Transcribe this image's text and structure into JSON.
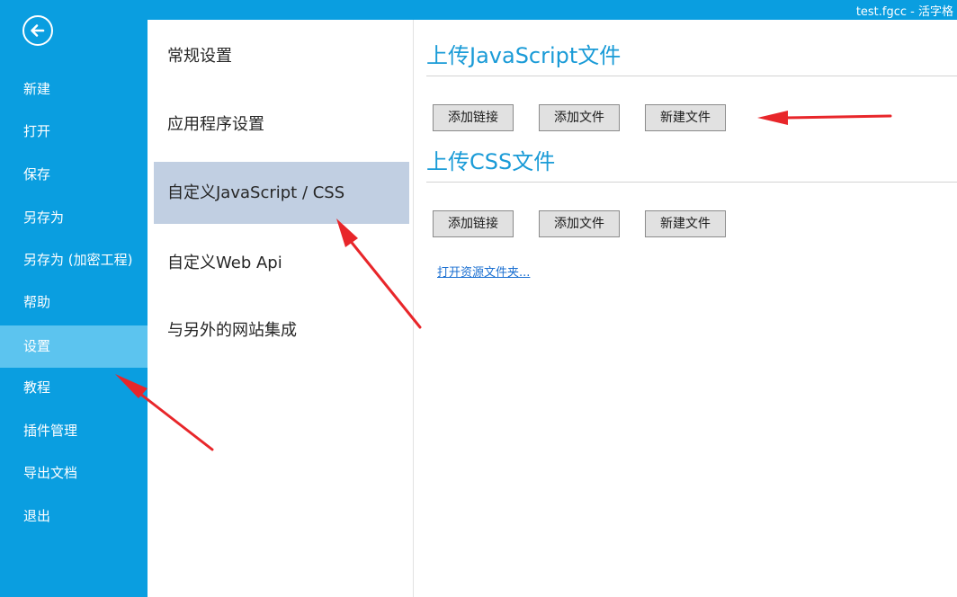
{
  "window": {
    "title": "test.fgcc - 活字格"
  },
  "sidebar": {
    "items": [
      {
        "label": "新建",
        "active": false
      },
      {
        "label": "打开",
        "active": false
      },
      {
        "label": "保存",
        "active": false
      },
      {
        "label": "另存为",
        "active": false
      },
      {
        "label": "另存为 (加密工程)",
        "active": false
      },
      {
        "label": "帮助",
        "active": false
      },
      {
        "label": "设置",
        "active": true
      },
      {
        "label": "教程",
        "active": false
      },
      {
        "label": "插件管理",
        "active": false
      },
      {
        "label": "导出文档",
        "active": false
      },
      {
        "label": "退出",
        "active": false
      }
    ]
  },
  "settings_nav": {
    "items": [
      {
        "label": "常规设置",
        "active": false
      },
      {
        "label": "应用程序设置",
        "active": false
      },
      {
        "label": "自定义JavaScript / CSS",
        "active": true
      },
      {
        "label": "自定义Web Api",
        "active": false
      },
      {
        "label": "与另外的网站集成",
        "active": false
      }
    ]
  },
  "content": {
    "js_section": {
      "title": "上传JavaScript文件",
      "add_link_label": "添加链接",
      "add_file_label": "添加文件",
      "new_file_label": "新建文件"
    },
    "css_section": {
      "title": "上传CSS文件",
      "add_link_label": "添加链接",
      "add_file_label": "添加文件",
      "new_file_label": "新建文件"
    },
    "open_folder_link": "打开资源文件夹..."
  },
  "colors": {
    "sidebar_bg": "#0a9ee0",
    "sidebar_active": "#5cc4ef",
    "nav_active": "#c1cfe2",
    "section_title": "#1a9bd7",
    "annotation_arrow": "#e8262a"
  }
}
